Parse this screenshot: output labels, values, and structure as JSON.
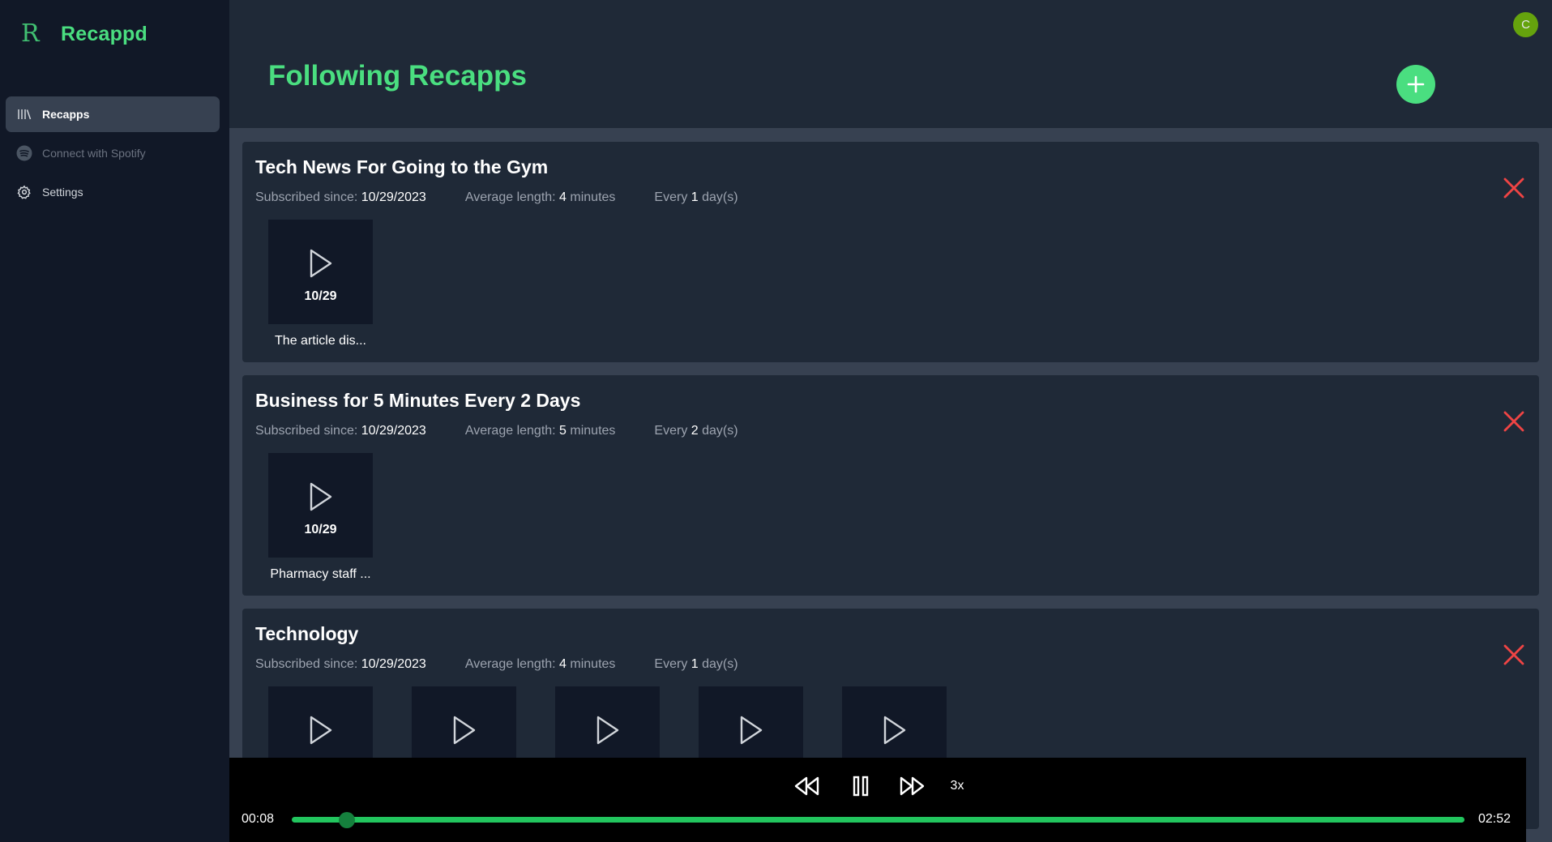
{
  "app": {
    "name": "Recappd",
    "logo_letter": "R"
  },
  "sidebar": {
    "items": [
      {
        "label": "Recapps",
        "icon": "library-icon",
        "state": "active"
      },
      {
        "label": "Connect with Spotify",
        "icon": "spotify-icon",
        "state": "disabled"
      },
      {
        "label": "Settings",
        "icon": "gear-icon",
        "state": "normal"
      }
    ]
  },
  "header": {
    "title": "Following Recapps",
    "avatar_initial": "C",
    "add_icon": "plus-icon"
  },
  "recapps": [
    {
      "title": "Tech News For Going to the Gym",
      "subscribed_label": "Subscribed since: ",
      "subscribed_date": "10/29/2023",
      "avg_label": "Average length: ",
      "avg_value": "4",
      "avg_unit": " minutes",
      "every_label": "Every ",
      "every_value": "1",
      "every_unit": " day(s)",
      "episodes": [
        {
          "date": "10/29",
          "caption": "The article dis..."
        }
      ]
    },
    {
      "title": "Business for 5 Minutes Every 2 Days",
      "subscribed_label": "Subscribed since: ",
      "subscribed_date": "10/29/2023",
      "avg_label": "Average length: ",
      "avg_value": "5",
      "avg_unit": " minutes",
      "every_label": "Every ",
      "every_value": "2",
      "every_unit": " day(s)",
      "episodes": [
        {
          "date": "10/29",
          "caption": "Pharmacy staff ..."
        }
      ]
    },
    {
      "title": "Technology",
      "subscribed_label": "Subscribed since: ",
      "subscribed_date": "10/29/2023",
      "avg_label": "Average length: ",
      "avg_value": "4",
      "avg_unit": " minutes",
      "every_label": "Every ",
      "every_value": "1",
      "every_unit": " day(s)",
      "episodes": [
        {
          "date": "",
          "caption": ""
        },
        {
          "date": "",
          "caption": ""
        },
        {
          "date": "",
          "caption": ""
        },
        {
          "date": "",
          "caption": ""
        },
        {
          "date": "",
          "caption": ""
        }
      ]
    }
  ],
  "player": {
    "current_time": "00:08",
    "total_time": "02:52",
    "speed": "3x",
    "progress_fraction": 0.047,
    "state": "playing"
  },
  "colors": {
    "accent": "#4ade80",
    "danger": "#ef4444",
    "sidebar_bg": "#111827",
    "main_bg": "#1f2937"
  }
}
